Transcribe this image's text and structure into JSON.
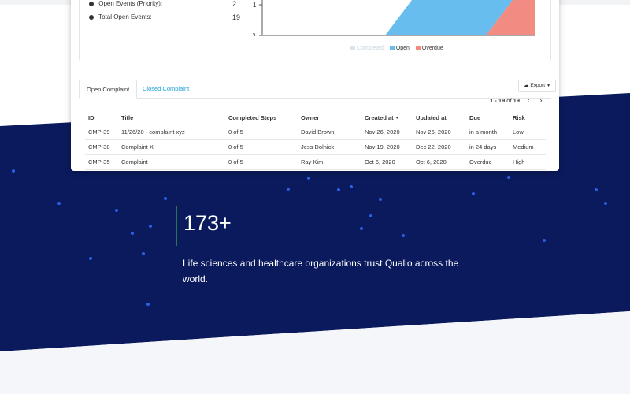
{
  "stats": {
    "row1_label": "Open Events (Priority):",
    "row1_value": "2",
    "row2_label": "Total Open Events:",
    "row2_value": "19"
  },
  "chart_data": {
    "type": "area",
    "y_ticks": [
      "1",
      "0"
    ],
    "legend": [
      {
        "label": "Completed",
        "color": "#d8e6ee"
      },
      {
        "label": "Open",
        "color": "#67bdee"
      },
      {
        "label": "Overdue",
        "color": "#f28b82"
      }
    ]
  },
  "tabs": {
    "open": "Open Complaint",
    "closed": "Closed Complaint"
  },
  "export": {
    "label": "Export",
    "icon": "cloud-icon"
  },
  "pagination": {
    "range": "1 - 19",
    "of": "of",
    "total": "19",
    "prev": "‹",
    "next": "›"
  },
  "table": {
    "headers": [
      "ID",
      "Title",
      "Completed Steps",
      "Owner",
      "Created at",
      "Updated at",
      "Due",
      "Risk"
    ],
    "rows": [
      [
        "CMP-39",
        "11/26/20 - complaint xyz",
        "0 of 5",
        "David Brown",
        "Nov 26, 2020",
        "Nov 26, 2020",
        "in a month",
        "Low"
      ],
      [
        "CMP-38",
        "Complaint X",
        "0 of 5",
        "Jess Dolnick",
        "Nov 19, 2020",
        "Dec 22, 2020",
        "in 24 days",
        "Medium"
      ],
      [
        "CMP-35",
        "Complaint",
        "0 of 5",
        "Ray Kim",
        "Oct 6, 2020",
        "Oct 6, 2020",
        "Overdue",
        "High"
      ]
    ]
  },
  "hero": {
    "stat": "173+",
    "copy": "Life sciences and healthcare organizations trust Qualio across the world."
  },
  "colors": {
    "navy": "#0a1a5c",
    "accent_blue": "#1a9fd8",
    "open": "#67bdee",
    "overdue": "#f28b82",
    "light_bg": "#f4f6f9"
  }
}
